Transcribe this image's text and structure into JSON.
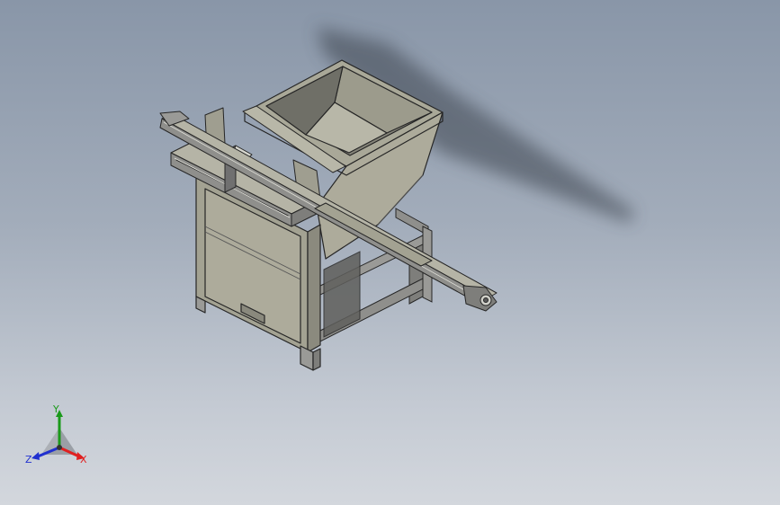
{
  "scene": {
    "background_top": "#8996a8",
    "background_bottom": "#d3d7dd",
    "model_color": "#adab9b",
    "edge_color": "#262626",
    "profile_color": "#8f8f8c"
  },
  "triad": {
    "x_label": "X",
    "y_label": "Y",
    "z_label": "Z",
    "x_color": "#e02020",
    "y_color": "#1a9a1a",
    "z_color": "#2030d0"
  }
}
